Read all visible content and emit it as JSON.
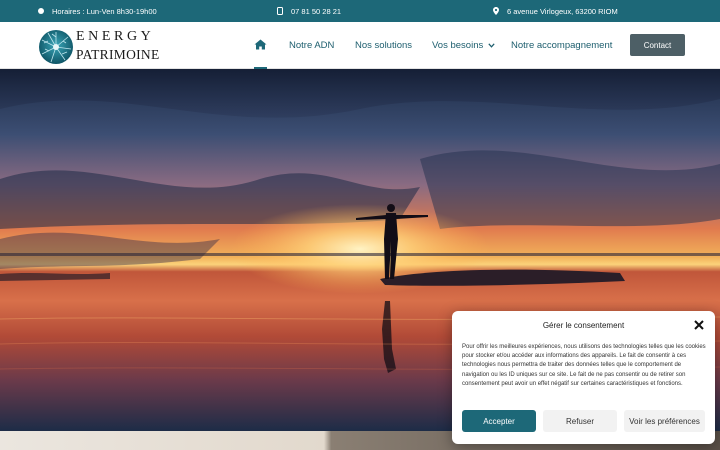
{
  "topbar": {
    "hours": "Horaires : Lun-Ven 8h30-19h00",
    "phone": "07 81 50 28 21",
    "address": "6 avenue Virlogeux, 63200 RIOM",
    "icons": [
      "clock-icon",
      "phone-icon",
      "map-pin-icon"
    ]
  },
  "brand": {
    "line1": "ENERGY",
    "line2": "PATRIMOINE",
    "color": "#1d6878"
  },
  "nav": {
    "home_icon": "home-icon",
    "items": [
      {
        "label": "Notre ADN"
      },
      {
        "label": "Nos solutions"
      },
      {
        "label": "Vos besoins"
      },
      {
        "label": "Notre accompagnement"
      }
    ],
    "contact_label": "Contact"
  },
  "consent": {
    "title": "Gérer le consentement",
    "body": "Pour offrir les meilleures expériences, nous utilisons des technologies telles que les cookies pour stocker et/ou accéder aux informations des appareils. Le fait de consentir à ces technologies nous permettra de traiter des données telles que le comportement de navigation ou les ID uniques sur ce site. Le fait de ne pas consentir ou de retirer son consentement peut avoir un effet négatif sur certaines caractéristiques et fonctions.",
    "accept": "Accepter",
    "refuse": "Refuser",
    "prefs": "Voir les préférences"
  },
  "colors": {
    "primary": "#1d6878",
    "contact_button": "#4d5f66"
  }
}
